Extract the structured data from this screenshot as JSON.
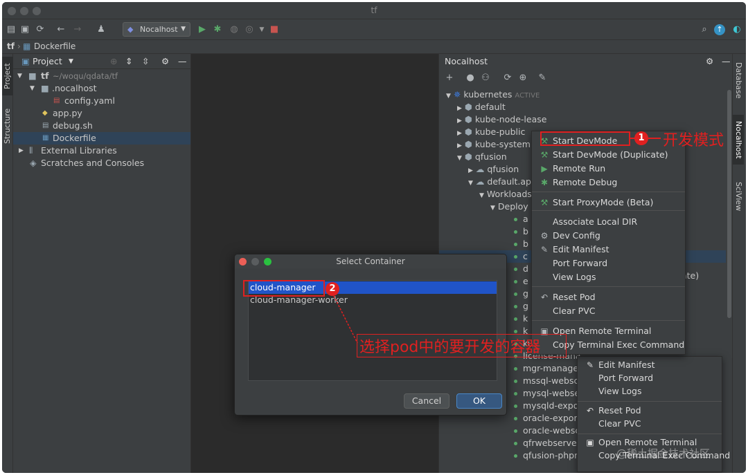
{
  "window": {
    "title": "tf"
  },
  "toolbar": {
    "run_config": "Nocalhost"
  },
  "breadcrumb": {
    "root": "tf",
    "file": "Dockerfile"
  },
  "left_strip": {
    "project_tab": "Project",
    "structure_tab": "Structure"
  },
  "project_panel": {
    "title": "Project",
    "tree": [
      {
        "label": "tf",
        "suffix": "~/woqu/qdata/tf"
      },
      {
        "label": ".nocalhost"
      },
      {
        "label": "config.yaml"
      },
      {
        "label": "app.py"
      },
      {
        "label": "debug.sh"
      },
      {
        "label": "Dockerfile"
      },
      {
        "label": "External Libraries"
      },
      {
        "label": "Scratches and Consoles"
      }
    ]
  },
  "nocalhost": {
    "title": "Nocalhost",
    "cluster": {
      "label": "kubernetes",
      "status": "ACTIVE"
    },
    "namespaces": [
      "default",
      "kube-node-lease",
      "kube-public",
      "kube-system",
      "qfusion"
    ],
    "apps": [
      "qfusion",
      "default.ap"
    ],
    "workloads": "Workloads",
    "deployments": "Deploy",
    "items": [
      "a",
      "b",
      "b",
      "c",
      "d",
      "e",
      "g",
      "g",
      "k",
      "k",
      "kube-state-r",
      "license-mana",
      "mgr-manage",
      "mssql-websc",
      "mysql-webse",
      "mysqld-expo",
      "oracle-expor",
      "oracle-websc",
      "qfrwebserve",
      "qfusion-phpmyadmin"
    ],
    "bg_partial_text": "ate)"
  },
  "right_strip": {
    "tab1": "Database",
    "tab2": "Nocalhost",
    "tab3": "SciView"
  },
  "context_menu": {
    "items": [
      {
        "label": "Start DevMode",
        "icon": "hammer-icon"
      },
      {
        "label": "Start DevMode (Duplicate)",
        "icon": "hammer-icon"
      },
      {
        "label": "Remote Run",
        "icon": "run-icon"
      },
      {
        "label": "Remote Debug",
        "icon": "bug-icon"
      },
      {
        "label": "Start ProxyMode (Beta)",
        "icon": "hammer-icon"
      },
      {
        "label": "Associate Local DIR",
        "icon": ""
      },
      {
        "label": "Dev Config",
        "icon": "gear-icon"
      },
      {
        "label": "Edit Manifest",
        "icon": "pencil-icon"
      },
      {
        "label": "Port Forward",
        "icon": ""
      },
      {
        "label": "View Logs",
        "icon": ""
      },
      {
        "label": "Reset Pod",
        "icon": "undo-icon"
      },
      {
        "label": "Clear PVC",
        "icon": ""
      },
      {
        "label": "Open Remote Terminal",
        "icon": "terminal-icon"
      },
      {
        "label": "Copy Terminal Exec Command",
        "icon": ""
      }
    ]
  },
  "bg_menu": {
    "items": [
      "Edit Manifest",
      "Port Forward",
      "View Logs",
      "Reset Pod",
      "Clear PVC",
      "Open Remote Terminal",
      "Copy Terminal Exec Command"
    ]
  },
  "dialog": {
    "title": "Select Container",
    "options": [
      "cloud-manager",
      "cloud-manager-worker"
    ],
    "cancel": "Cancel",
    "ok": "OK"
  },
  "annotations": {
    "badge1": "1",
    "label1": "开发模式",
    "badge2": "2",
    "label2": "选择pod中的要开发的容器"
  },
  "watermark": "@稀土掘金技术社区",
  "colors": {
    "accent_red": "#e02020",
    "selection_blue": "#2054c8",
    "active_green": "#59a869"
  }
}
